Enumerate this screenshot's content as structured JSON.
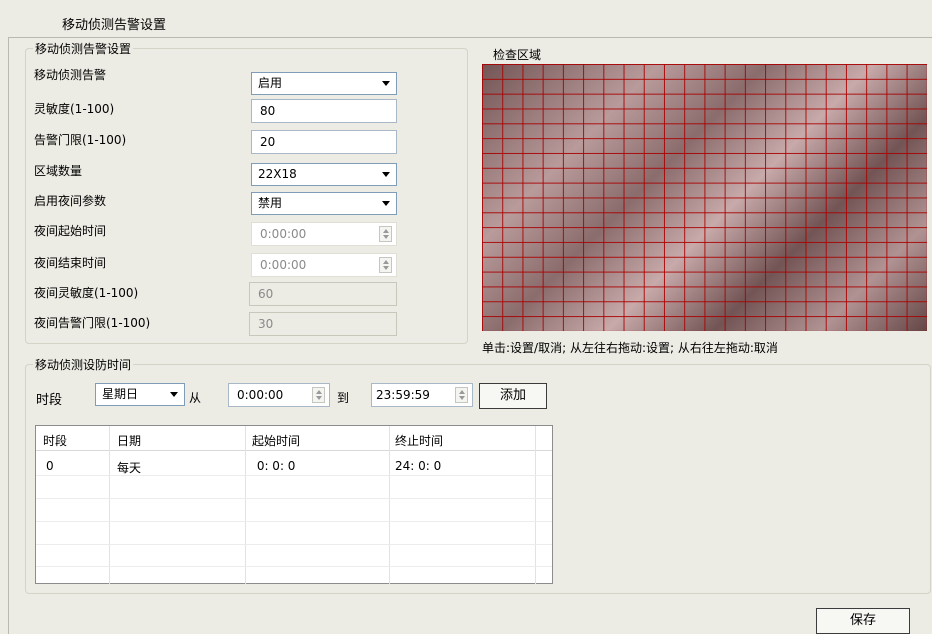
{
  "window": {
    "title": "移动侦测告警设置"
  },
  "settings_group": {
    "label": "移动侦测告警设置",
    "rows": [
      {
        "label": "移动侦测告警",
        "value": "启用",
        "type": "combo"
      },
      {
        "label": "灵敏度(1-100)",
        "value": "80",
        "type": "text"
      },
      {
        "label": "告警门限(1-100)",
        "value": "20",
        "type": "text"
      },
      {
        "label": "区域数量",
        "value": "22X18",
        "type": "combo"
      },
      {
        "label": "启用夜间参数",
        "value": "禁用",
        "type": "combo"
      },
      {
        "label": "夜间起始时间",
        "value": "0:00:00",
        "type": "spin-disabled"
      },
      {
        "label": "夜间结束时间",
        "value": "0:00:00",
        "type": "spin-disabled"
      },
      {
        "label": "夜间灵敏度(1-100)",
        "value": "60",
        "type": "text-disabled"
      },
      {
        "label": "夜间告警门限(1-100)",
        "value": "30",
        "type": "text-disabled"
      }
    ]
  },
  "check_area": {
    "label": "检查区域",
    "grid_cols": 22,
    "grid_rows": 18,
    "hint": "单击:设置/取消; 从左往右拖动:设置; 从右往左拖动:取消"
  },
  "schedule_group": {
    "label": "移动侦测设防时间",
    "period_label": "时段",
    "day_value": "星期日",
    "from_label": "从",
    "start_time": "0:00:00",
    "to_label": "到",
    "end_time": "23:59:59",
    "add_button": "添加",
    "table": {
      "headers": [
        "时段",
        "日期",
        "起始时间",
        "终止时间"
      ],
      "rows": [
        [
          "0",
          "每天",
          " 0: 0: 0",
          "24: 0: 0"
        ]
      ]
    }
  },
  "save_button": "保存",
  "colors": {
    "grid": "#aa0000",
    "background": "#ecebe4",
    "input_border": "#7f9db9"
  }
}
